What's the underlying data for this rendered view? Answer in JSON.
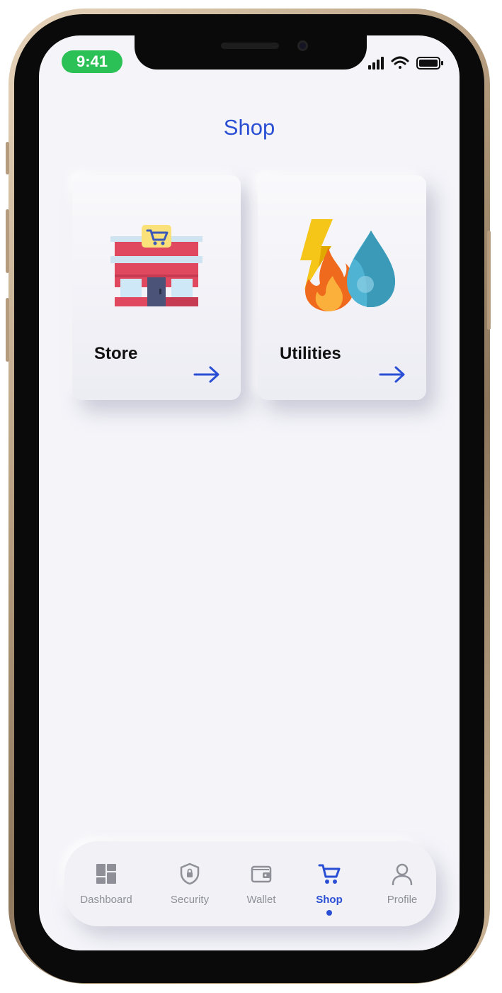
{
  "status_bar": {
    "time": "9:41"
  },
  "header": {
    "title": "Shop"
  },
  "cards": [
    {
      "label": "Store",
      "icon": "store-icon"
    },
    {
      "label": "Utilities",
      "icon": "utilities-icon"
    }
  ],
  "nav": {
    "items": [
      {
        "label": "Dashboard",
        "icon": "dashboard-icon",
        "active": false
      },
      {
        "label": "Security",
        "icon": "shield-icon",
        "active": false
      },
      {
        "label": "Wallet",
        "icon": "wallet-icon",
        "active": false
      },
      {
        "label": "Shop",
        "icon": "cart-icon",
        "active": true
      },
      {
        "label": "Profile",
        "icon": "user-icon",
        "active": false
      }
    ]
  },
  "colors": {
    "accent": "#2a4fd4",
    "time_pill": "#2cc156",
    "inactive": "#8f8f98"
  }
}
